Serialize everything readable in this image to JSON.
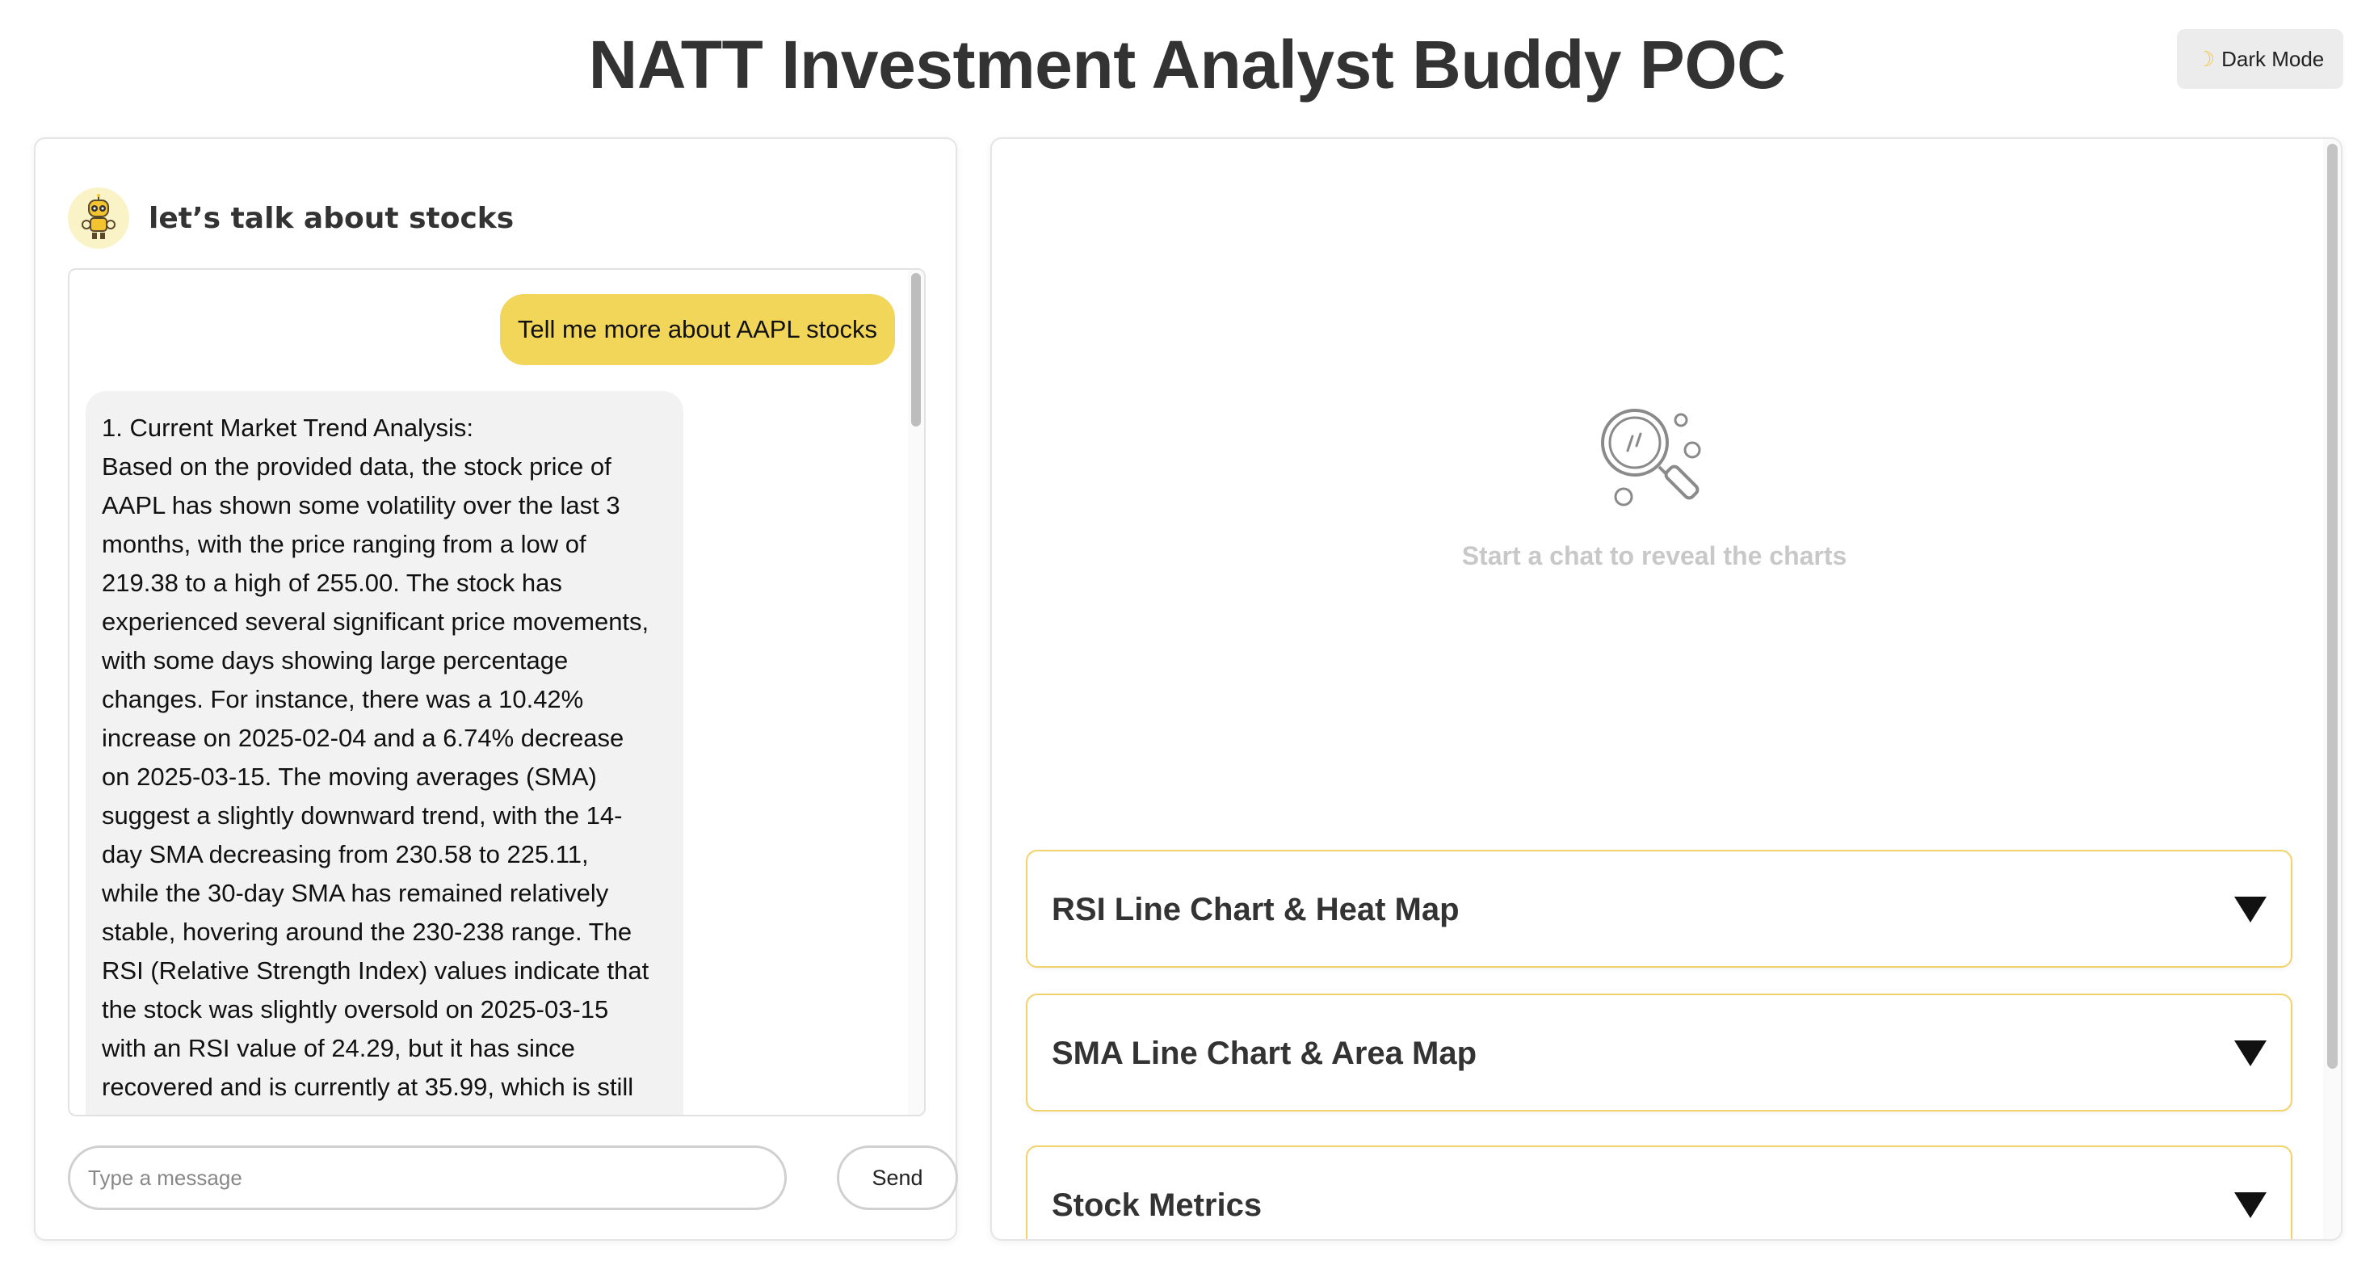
{
  "app": {
    "title": "NATT Investment Analyst Buddy POC",
    "dark_mode_label": "Dark Mode",
    "dark_mode_icon": "moon-icon"
  },
  "chat": {
    "title": "let’s talk about stocks",
    "avatar_icon": "robot-icon",
    "user_message": "Tell me more about AAPL stocks",
    "bot_message_lines": [
      "1. Current Market Trend Analysis:",
      "Based on the provided data, the stock price of",
      "AAPL has shown some volatility over the last 3",
      "months, with the price ranging from a low of",
      "219.38 to a high of 255.00. The stock has",
      "experienced several significant price movements,",
      "with some days showing large percentage",
      "changes. For instance, there was a 10.42%",
      "increase on 2025-02-04 and a 6.74% decrease",
      "on 2025-03-15. The moving averages (SMA)",
      "suggest a slightly downward trend, with the 14-",
      "day SMA decreasing from 230.58 to 225.11,",
      "while the 30-day SMA has remained relatively",
      "stable, hovering around the 230-238 range. The",
      "RSI (Relative Strength Index) values indicate that",
      "the stock was slightly oversold on 2025-03-15",
      "with an RSI value of 24.29, but it has since",
      "recovered and is currently at 35.99, which is still"
    ],
    "input_placeholder": "Type a message",
    "input_value": "",
    "send_label": "Send"
  },
  "charts": {
    "empty_icon": "search-magnifier-icon",
    "empty_text": "Start a chat to reveal the charts",
    "sections": [
      {
        "label": "RSI Line Chart & Heat Map",
        "expanded": false
      },
      {
        "label": "SMA Line Chart & Area Map",
        "expanded": false
      },
      {
        "label": "Stock Metrics",
        "expanded": false
      }
    ]
  },
  "colors": {
    "accent_yellow": "#f2d65a",
    "accordion_border": "#f2d36b",
    "bot_bubble": "#f2f2f2",
    "muted_text": "#c8c8c8"
  }
}
